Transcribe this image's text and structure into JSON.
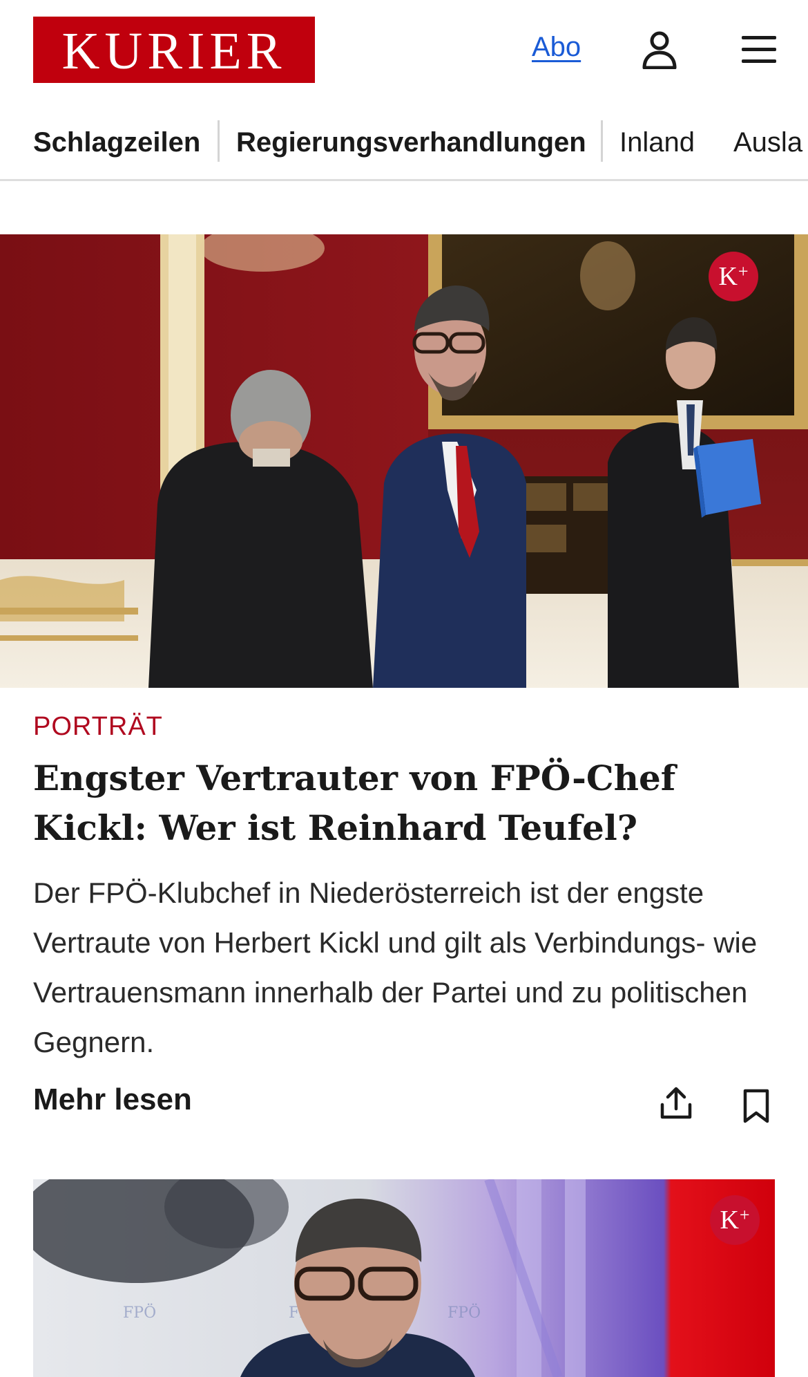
{
  "header": {
    "logo_text": "KURIER",
    "abo_label": "Abo",
    "user_icon": "user-icon",
    "menu_icon": "hamburger-menu-icon"
  },
  "nav": {
    "items": [
      {
        "label": "Schlagzeilen"
      },
      {
        "label": "Regierungsverhandlungen"
      },
      {
        "label": "Inland"
      },
      {
        "label": "Ausla"
      }
    ]
  },
  "articles": [
    {
      "badge": "K+",
      "kicker": "PORTRÄT",
      "headline": "Engster Vertrauter von FPÖ-Chef Kickl: Wer ist Reinhard Teufel?",
      "teaser": "Der FPÖ-Klubchef in Niederösterreich ist der engste Vertraute von Herbert Kickl und gilt als Verbindungs- wie Vertrauensmann innerhalb der Partei und zu politischen Gegnern.",
      "more_label": "Mehr lesen",
      "share_icon": "share-icon",
      "bookmark_icon": "bookmark-icon"
    },
    {
      "badge": "K+"
    }
  ],
  "colors": {
    "brand_red": "#c0000d",
    "kicker_red": "#b0081f",
    "link_blue": "#1a5bd6"
  }
}
